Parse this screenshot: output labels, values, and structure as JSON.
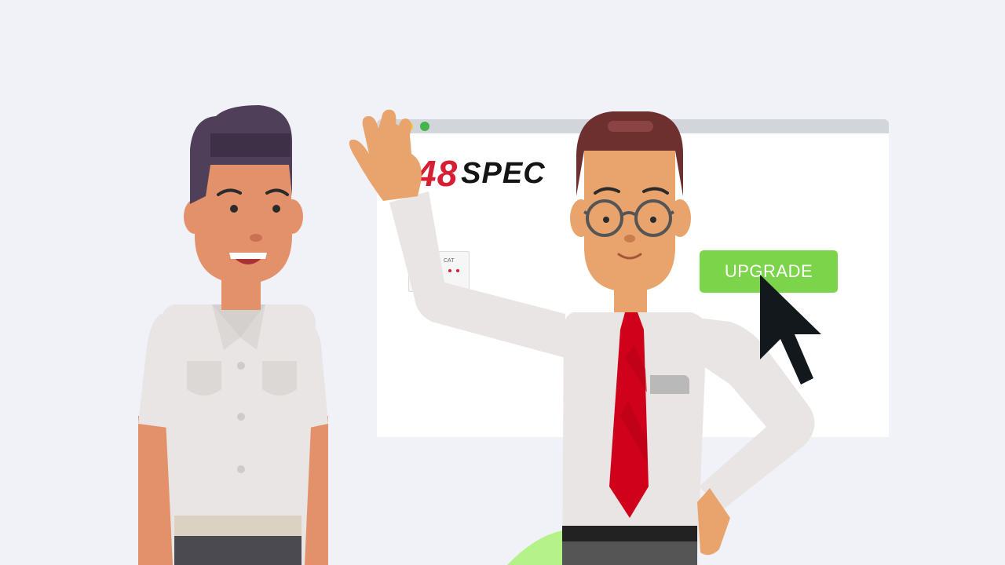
{
  "browser": {
    "logo_prefix": "48",
    "logo_suffix": "SPEC",
    "mini_card_text": "CAT"
  },
  "cta": {
    "upgrade_label": "UPGRADE"
  },
  "icons": {
    "cursor": "mouse-pointer-icon"
  },
  "colors": {
    "background": "#f1f2f8",
    "upgrade_button": "#7cd44a",
    "brand_red": "#d81e32",
    "tie_red": "#d0021b"
  }
}
